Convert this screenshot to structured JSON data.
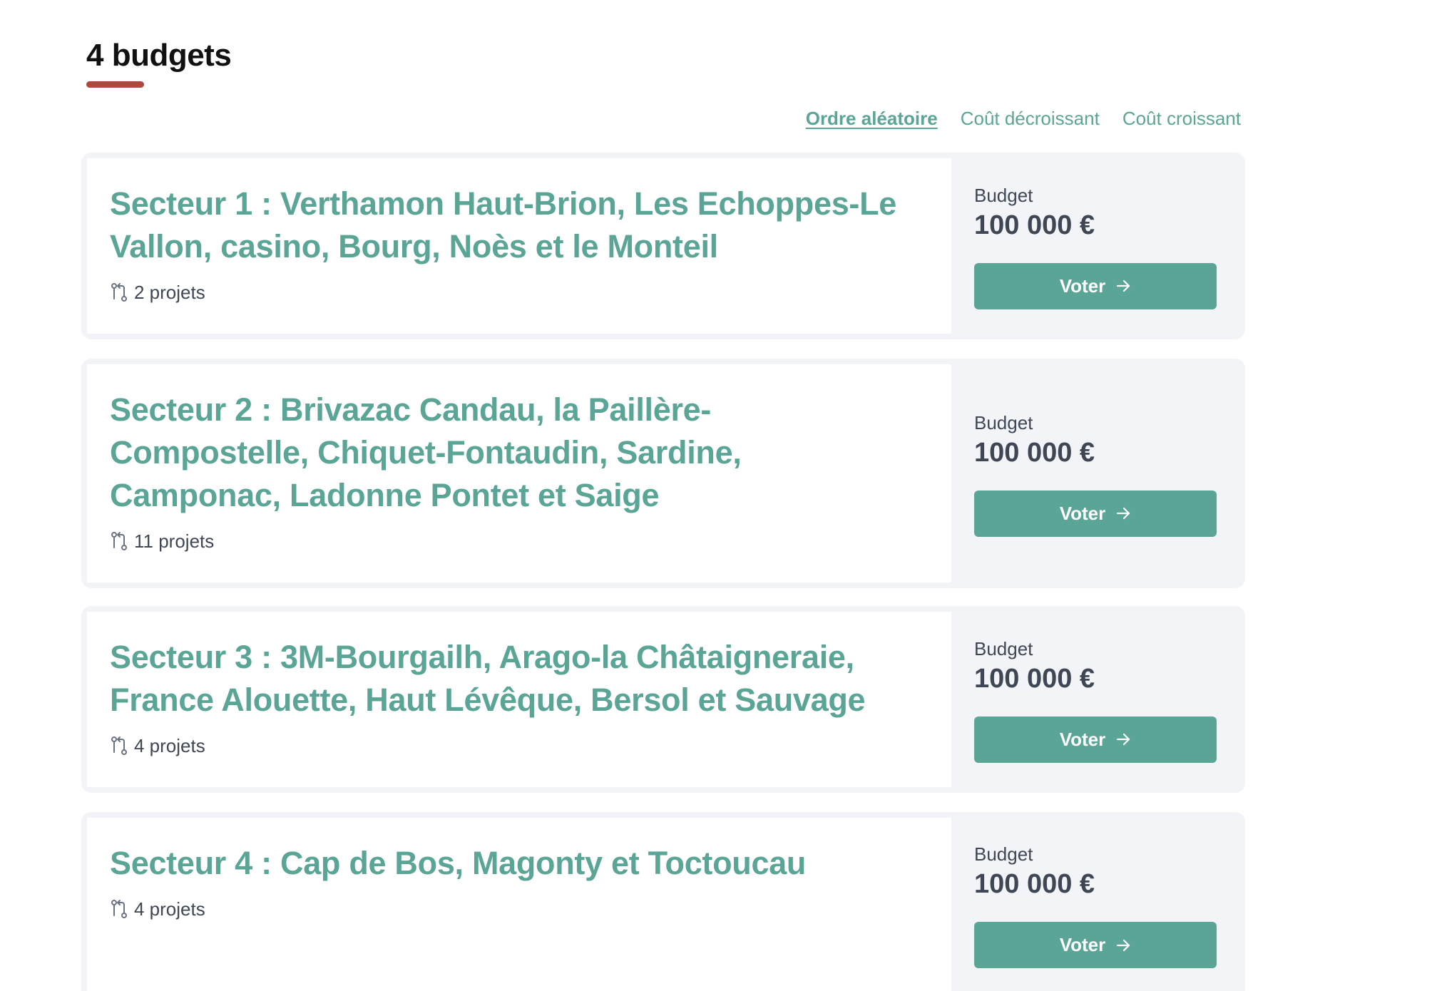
{
  "heading": "4 budgets",
  "sort_options": [
    {
      "label": "Ordre aléatoire",
      "active": true
    },
    {
      "label": "Coût décroissant",
      "active": false
    },
    {
      "label": "Coût croissant",
      "active": false
    }
  ],
  "budgets": [
    {
      "title": "Secteur 1 : Verthamon Haut-Brion, Les Echoppes-Le Vallon, casino, Bourg, Noès et le Monteil",
      "projects": "2 projets",
      "budget_label": "Budget",
      "budget_value": "100 000 €",
      "vote_label": "Voter"
    },
    {
      "title": "Secteur 2 : Brivazac Candau, la Paillère-Compostelle, Chiquet-Fontaudin, Sardine, Camponac, Ladonne Pontet et Saige",
      "projects": "11 projets",
      "budget_label": "Budget",
      "budget_value": "100 000 €",
      "vote_label": "Voter"
    },
    {
      "title": "Secteur 3 : 3M-Bourgailh, Arago-la Châtaigneraie, France Alouette, Haut Lévêque, Bersol et Sauvage",
      "projects": "4 projets",
      "budget_label": "Budget",
      "budget_value": "100 000 €",
      "vote_label": "Voter"
    },
    {
      "title": "Secteur 4 : Cap de Bos, Magonty et Toctoucau",
      "projects": "4 projets",
      "budget_label": "Budget",
      "budget_value": "100 000 €",
      "vote_label": "Voter"
    }
  ],
  "icons": {
    "projects": "git-compare-icon",
    "vote": "arrow-right-icon"
  },
  "colors": {
    "accent": "#5ba597",
    "heading_underline": "#b0463d",
    "card_background": "#f2f4f7",
    "text": "#3f4754"
  }
}
